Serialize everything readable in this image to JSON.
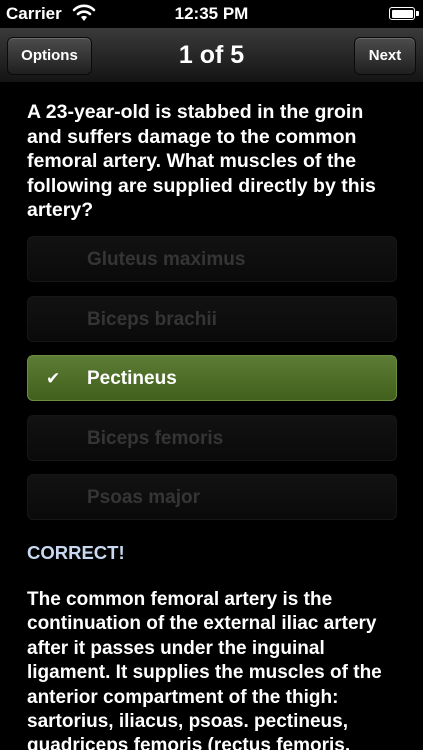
{
  "status_bar": {
    "carrier": "Carrier",
    "time": "12:35 PM"
  },
  "nav": {
    "left_button": "Options",
    "title": "1 of 5",
    "right_button": "Next"
  },
  "question": "A 23-year-old is stabbed in the groin and suffers damage to the common femoral artery. What muscles of the following are supplied directly by this artery?",
  "answers": [
    {
      "label": "Gluteus maximus",
      "selected": false
    },
    {
      "label": "Biceps brachii",
      "selected": false
    },
    {
      "label": "Pectineus",
      "selected": true,
      "check": "✔"
    },
    {
      "label": "Biceps femoris",
      "selected": false
    },
    {
      "label": "Psoas major",
      "selected": false
    }
  ],
  "result": "CORRECT!",
  "explanation": "The common femoral artery is the continuation of the external iliac artery after it passes under the inguinal ligament. It supplies the muscles of the anterior compartment of the thigh: sartorius, iliacus, psoas. pectineus, quadriceps femoris (rectus femoris,",
  "colors": {
    "selected_answer": "#4f6e28",
    "result_text": "#c8d8f0"
  }
}
